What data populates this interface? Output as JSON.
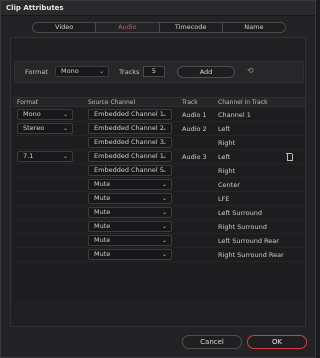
{
  "window": {
    "title": "Clip Attributes"
  },
  "tabs": [
    {
      "label": "Video",
      "active": false
    },
    {
      "label": "Audio",
      "active": true
    },
    {
      "label": "Timecode",
      "active": false
    },
    {
      "label": "Name",
      "active": false
    }
  ],
  "toolbar": {
    "format_label": "Format",
    "format_value": "Mono",
    "tracks_label": "Tracks",
    "tracks_value": "5",
    "add_label": "Add",
    "reset_icon": "reset-icon"
  },
  "table": {
    "headers": [
      "Format",
      "Source Channel",
      "Track",
      "Channel in Track"
    ],
    "rows": [
      {
        "format": "Mono",
        "source": "Embedded Channel 1",
        "track": "Audio 1",
        "channel": "Channel 1",
        "delete": false
      },
      {
        "format": "Stereo",
        "source": "Embedded Channel 2",
        "track": "Audio 2",
        "channel": "Left",
        "delete": false
      },
      {
        "format": "",
        "source": "Embedded Channel 3",
        "track": "",
        "channel": "Right",
        "delete": false
      },
      {
        "format": "7.1",
        "source": "Embedded Channel 1",
        "track": "Audio 3",
        "channel": "Left",
        "delete": true
      },
      {
        "format": "",
        "source": "Embedded Channel 5",
        "track": "",
        "channel": "Right",
        "delete": false
      },
      {
        "format": "",
        "source": "Mute",
        "track": "",
        "channel": "Center",
        "delete": false
      },
      {
        "format": "",
        "source": "Mute",
        "track": "",
        "channel": "LFE",
        "delete": false
      },
      {
        "format": "",
        "source": "Mute",
        "track": "",
        "channel": "Left Surround",
        "delete": false
      },
      {
        "format": "",
        "source": "Mute",
        "track": "",
        "channel": "Right Surround",
        "delete": false
      },
      {
        "format": "",
        "source": "Mute",
        "track": "",
        "channel": "Left Surround Rear",
        "delete": false
      },
      {
        "format": "",
        "source": "Mute",
        "track": "",
        "channel": "Right Surround Rear",
        "delete": false
      }
    ]
  },
  "footer": {
    "cancel_label": "Cancel",
    "ok_label": "OK"
  },
  "colors": {
    "accent": "#e05050",
    "ok_border": "#d04040",
    "background": "#232325"
  }
}
